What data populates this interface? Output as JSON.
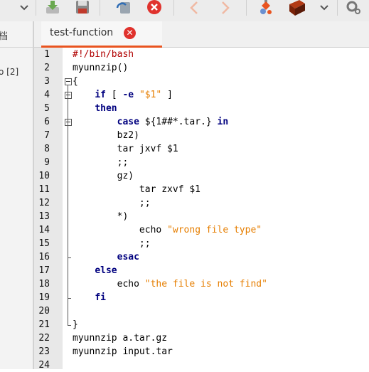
{
  "toolbar": {
    "icons": [
      "chevron-down-icon",
      "save-down-icon",
      "floppy-save-icon",
      "revert-icon",
      "close-document-icon",
      "back-arrow-icon",
      "forward-arrow-icon",
      "build-icon",
      "brick-icon",
      "chevron-down-icon",
      "settings-icon"
    ],
    "colors": {
      "close": "#e0322d",
      "build": "#e95420",
      "brick": "#8b2a10"
    }
  },
  "sidebar": {
    "tab_label": "档",
    "item_label": "o [2]"
  },
  "tabs": [
    {
      "label": "test-function",
      "active": true,
      "close_icon": "close-icon"
    }
  ],
  "editor": {
    "line_numbers": [
      "1",
      "2",
      "3",
      "4",
      "5",
      "6",
      "7",
      "8",
      "9",
      "10",
      "11",
      "12",
      "13",
      "14",
      "15",
      "16",
      "17",
      "18",
      "19",
      "20",
      "21",
      "22",
      "23",
      "24"
    ],
    "lines": [
      {
        "segments": [
          {
            "text": "#!/bin/bash",
            "style": "cm"
          }
        ]
      },
      {
        "segments": [
          {
            "text": "myunnzip()",
            "style": ""
          }
        ]
      },
      {
        "segments": [
          {
            "text": "{",
            "style": ""
          }
        ]
      },
      {
        "segments": [
          {
            "text": "    ",
            "style": ""
          },
          {
            "text": "if",
            "style": "kw"
          },
          {
            "text": " [ ",
            "style": ""
          },
          {
            "text": "-e",
            "style": "kw"
          },
          {
            "text": " ",
            "style": ""
          },
          {
            "text": "\"$1\"",
            "style": "str"
          },
          {
            "text": " ]",
            "style": ""
          }
        ]
      },
      {
        "segments": [
          {
            "text": "    ",
            "style": ""
          },
          {
            "text": "then",
            "style": "kw"
          }
        ]
      },
      {
        "segments": [
          {
            "text": "        ",
            "style": ""
          },
          {
            "text": "case",
            "style": "kw"
          },
          {
            "text": " ${1##*.tar.} ",
            "style": ""
          },
          {
            "text": "in",
            "style": "kw"
          }
        ]
      },
      {
        "segments": [
          {
            "text": "        bz2)",
            "style": ""
          }
        ]
      },
      {
        "segments": [
          {
            "text": "        tar jxvf $1",
            "style": ""
          }
        ]
      },
      {
        "segments": [
          {
            "text": "        ;;",
            "style": ""
          }
        ]
      },
      {
        "segments": [
          {
            "text": "        gz)",
            "style": ""
          }
        ]
      },
      {
        "segments": [
          {
            "text": "            tar zxvf $1",
            "style": ""
          }
        ]
      },
      {
        "segments": [
          {
            "text": "            ;;",
            "style": ""
          }
        ]
      },
      {
        "segments": [
          {
            "text": "        *)",
            "style": ""
          }
        ]
      },
      {
        "segments": [
          {
            "text": "            echo ",
            "style": ""
          },
          {
            "text": "\"wrong file type\"",
            "style": "str"
          }
        ]
      },
      {
        "segments": [
          {
            "text": "            ;;",
            "style": ""
          }
        ]
      },
      {
        "segments": [
          {
            "text": "        ",
            "style": ""
          },
          {
            "text": "esac",
            "style": "kw"
          }
        ]
      },
      {
        "segments": [
          {
            "text": "    ",
            "style": ""
          },
          {
            "text": "else",
            "style": "kw"
          }
        ]
      },
      {
        "segments": [
          {
            "text": "        echo ",
            "style": ""
          },
          {
            "text": "\"the file is not find\"",
            "style": "str"
          }
        ]
      },
      {
        "segments": [
          {
            "text": "    ",
            "style": ""
          },
          {
            "text": "fi",
            "style": "kw"
          }
        ]
      },
      {
        "segments": [
          {
            "text": "",
            "style": ""
          }
        ]
      },
      {
        "segments": [
          {
            "text": "}",
            "style": ""
          }
        ]
      },
      {
        "segments": [
          {
            "text": "myunnzip a.tar.gz",
            "style": ""
          }
        ]
      },
      {
        "segments": [
          {
            "text": "myunnzip input.tar",
            "style": ""
          }
        ]
      },
      {
        "segments": [
          {
            "text": "",
            "style": ""
          }
        ]
      }
    ],
    "colors": {
      "keyword": "#00007f",
      "string": "#e67e00",
      "comment": "#b00000"
    }
  }
}
